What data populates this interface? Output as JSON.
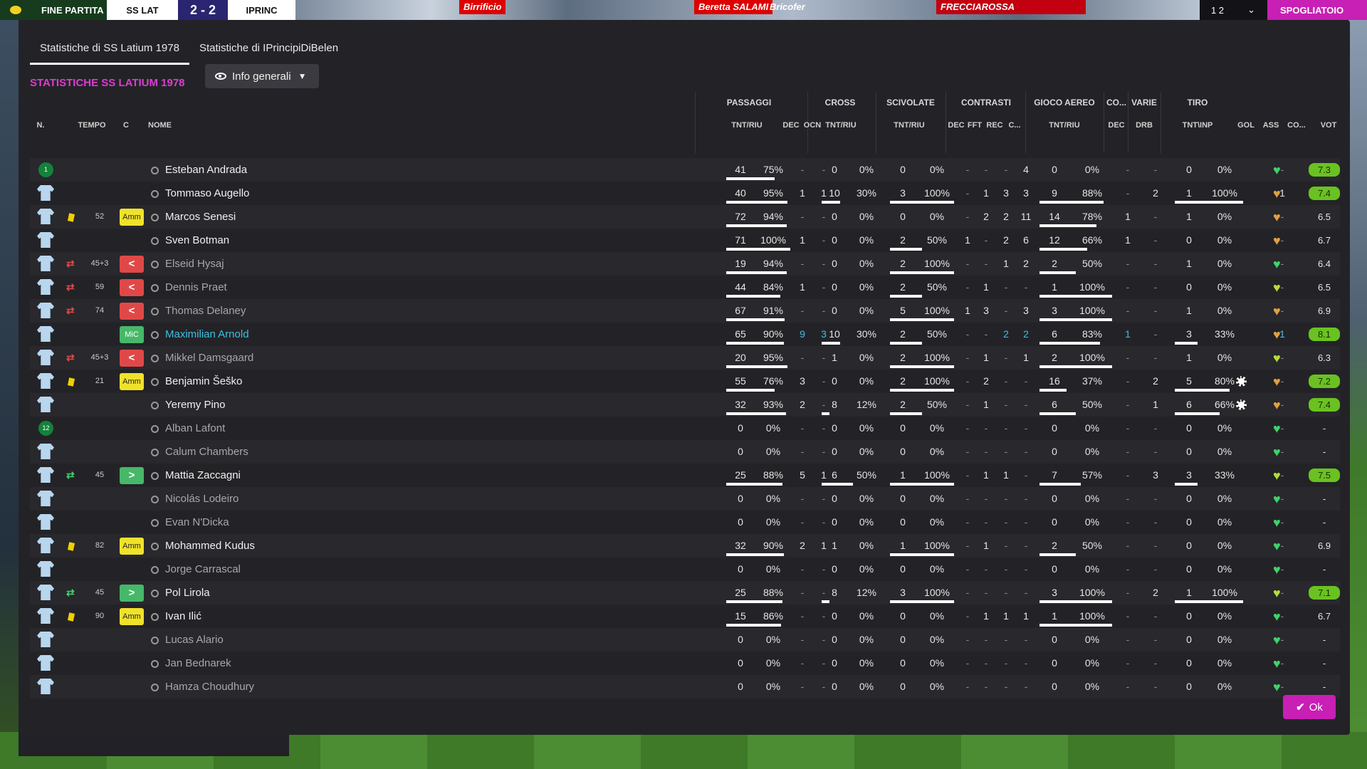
{
  "topbar": {
    "match_state": "FINE PARTITA",
    "home_short": "SS LAT",
    "score": "2 - 2",
    "away_short": "IPRINC",
    "ads": [
      "Birrificio",
      "Beretta SALAMI",
      "Bricofer",
      "FRECCIAROSSA"
    ],
    "control_1": "1 2",
    "control_2": "⌄",
    "menu_label": "SPOGLIATOIO"
  },
  "tabs": [
    {
      "label": "Statistiche di SS Latium 1978",
      "active": true
    },
    {
      "label": "Statistiche di IPrincipiDiBelen",
      "active": false
    }
  ],
  "section_title": "STATISTICHE SS LATIUM 1978",
  "view_dropdown": {
    "label": "Info generali"
  },
  "group_headers": [
    "PASSAGGI",
    "CROSS",
    "SCIVOLATE",
    "CONTRASTI",
    "GIOCO AEREO",
    "CO...",
    "VARIE",
    "TIRO"
  ],
  "column_headers": {
    "n": "N.",
    "tempo": "TEMPO",
    "c": "C",
    "nome": "NOME",
    "pass_tnt": "TNT/RIU",
    "dec": "DEC",
    "ocn": "OCN",
    "cross_tnt": "TNT/RIU",
    "scivolate_tnt": "TNT/RIU",
    "contr_dec": "DEC",
    "contr_fft": "FFT",
    "contr_rec": "REC",
    "contr_c": "C...",
    "aereo_tnt": "TNT/RIU",
    "co_dec": "DEC",
    "drb": "DRB",
    "tiro_tnt": "TNT\\INP",
    "gol": "GOL",
    "ass": "ASS",
    "co": "CO...",
    "vot": "VOT"
  },
  "heart_colors": {
    "green": "#3fd26a",
    "lime": "#b6dc3a",
    "orange": "#e0a040"
  },
  "accent": "#c81fb4",
  "players": [
    {
      "name": "Esteban Andrada",
      "status": "gk",
      "gk_num": "1",
      "yellow": false,
      "sub": "",
      "minute": "",
      "badge": "",
      "pass": "41",
      "pass_p": "75%",
      "pdec": "-",
      "pocn": "-",
      "cross": "0",
      "cross_p": "0%",
      "sciv": "0",
      "sciv_p": "0%",
      "cdec": "-",
      "cfft": "-",
      "crec": "-",
      "cc": "4",
      "aereo": "0",
      "aereo_p": "0%",
      "codec": "-",
      "drb": "-",
      "tiro": "0",
      "tiro_p": "0%",
      "gol": "",
      "ass": "-",
      "heart": "green",
      "vot": "7.3",
      "vot_hi": true,
      "dim": false,
      "cyan": false
    },
    {
      "name": "Tommaso Augello",
      "status": "",
      "gk_num": "",
      "yellow": false,
      "sub": "",
      "minute": "",
      "badge": "",
      "pass": "40",
      "pass_p": "95%",
      "pdec": "1",
      "pocn": "1",
      "cross": "10",
      "cross_p": "30%",
      "sciv": "3",
      "sciv_p": "100%",
      "cdec": "-",
      "cfft": "1",
      "crec": "3",
      "cc": "3",
      "aereo": "9",
      "aereo_p": "88%",
      "codec": "-",
      "drb": "2",
      "tiro": "1",
      "tiro_p": "100%",
      "gol": "",
      "ass": "1",
      "heart": "orange",
      "vot": "7.4",
      "vot_hi": true,
      "dim": false,
      "cyan": false
    },
    {
      "name": "Marcos Senesi",
      "status": "",
      "gk_num": "",
      "yellow": true,
      "sub": "",
      "minute": "52",
      "badge": "Amm",
      "pass": "72",
      "pass_p": "94%",
      "pdec": "-",
      "pocn": "-",
      "cross": "0",
      "cross_p": "0%",
      "sciv": "0",
      "sciv_p": "0%",
      "cdec": "-",
      "cfft": "2",
      "crec": "2",
      "cc": "11",
      "aereo": "14",
      "aereo_p": "78%",
      "codec": "1",
      "drb": "-",
      "tiro": "1",
      "tiro_p": "0%",
      "gol": "",
      "ass": "-",
      "heart": "orange",
      "vot": "6.5",
      "vot_hi": false,
      "dim": false,
      "cyan": false
    },
    {
      "name": "Sven Botman",
      "status": "",
      "gk_num": "",
      "yellow": false,
      "sub": "",
      "minute": "",
      "badge": "",
      "pass": "71",
      "pass_p": "100%",
      "pdec": "1",
      "pocn": "-",
      "cross": "0",
      "cross_p": "0%",
      "sciv": "2",
      "sciv_p": "50%",
      "cdec": "1",
      "cfft": "-",
      "crec": "2",
      "cc": "6",
      "aereo": "12",
      "aereo_p": "66%",
      "codec": "1",
      "drb": "-",
      "tiro": "0",
      "tiro_p": "0%",
      "gol": "",
      "ass": "-",
      "heart": "orange",
      "vot": "6.7",
      "vot_hi": false,
      "dim": false,
      "cyan": false
    },
    {
      "name": "Elseid Hysaj",
      "status": "",
      "gk_num": "",
      "yellow": false,
      "sub": "out",
      "minute": "45+3",
      "badge": "<",
      "pass": "19",
      "pass_p": "94%",
      "pdec": "-",
      "pocn": "-",
      "cross": "0",
      "cross_p": "0%",
      "sciv": "2",
      "sciv_p": "100%",
      "cdec": "-",
      "cfft": "-",
      "crec": "1",
      "cc": "2",
      "aereo": "2",
      "aereo_p": "50%",
      "codec": "-",
      "drb": "-",
      "tiro": "1",
      "tiro_p": "0%",
      "gol": "",
      "ass": "-",
      "heart": "green",
      "vot": "6.4",
      "vot_hi": false,
      "dim": true,
      "cyan": false
    },
    {
      "name": "Dennis Praet",
      "status": "",
      "gk_num": "",
      "yellow": false,
      "sub": "out",
      "minute": "59",
      "badge": "<",
      "pass": "44",
      "pass_p": "84%",
      "pdec": "1",
      "pocn": "-",
      "cross": "0",
      "cross_p": "0%",
      "sciv": "2",
      "sciv_p": "50%",
      "cdec": "-",
      "cfft": "1",
      "crec": "-",
      "cc": "-",
      "aereo": "1",
      "aereo_p": "100%",
      "codec": "-",
      "drb": "-",
      "tiro": "0",
      "tiro_p": "0%",
      "gol": "",
      "ass": "-",
      "heart": "lime",
      "vot": "6.5",
      "vot_hi": false,
      "dim": true,
      "cyan": false
    },
    {
      "name": "Thomas Delaney",
      "status": "",
      "gk_num": "",
      "yellow": false,
      "sub": "out",
      "minute": "74",
      "badge": "<",
      "pass": "67",
      "pass_p": "91%",
      "pdec": "-",
      "pocn": "-",
      "cross": "0",
      "cross_p": "0%",
      "sciv": "5",
      "sciv_p": "100%",
      "cdec": "1",
      "cfft": "3",
      "crec": "-",
      "cc": "3",
      "aereo": "3",
      "aereo_p": "100%",
      "codec": "-",
      "drb": "-",
      "tiro": "1",
      "tiro_p": "0%",
      "gol": "",
      "ass": "-",
      "heart": "orange",
      "vot": "6.9",
      "vot_hi": false,
      "dim": true,
      "cyan": false
    },
    {
      "name": "Maximilian Arnold",
      "status": "",
      "gk_num": "",
      "yellow": false,
      "sub": "",
      "minute": "",
      "badge": "MiC",
      "pass": "65",
      "pass_p": "90%",
      "pdec": "9",
      "pocn": "3",
      "cross": "10",
      "cross_p": "30%",
      "sciv": "2",
      "sciv_p": "50%",
      "cdec": "-",
      "cfft": "-",
      "crec": "2",
      "cc": "2",
      "aereo": "6",
      "aereo_p": "83%",
      "codec": "1",
      "drb": "-",
      "tiro": "3",
      "tiro_p": "33%",
      "gol": "",
      "ass": "1",
      "heart": "orange",
      "vot": "8.1",
      "vot_hi": true,
      "dim": false,
      "cyan": true
    },
    {
      "name": "Mikkel Damsgaard",
      "status": "",
      "gk_num": "",
      "yellow": false,
      "sub": "out",
      "minute": "45+3",
      "badge": "<",
      "pass": "20",
      "pass_p": "95%",
      "pdec": "-",
      "pocn": "-",
      "cross": "1",
      "cross_p": "0%",
      "sciv": "2",
      "sciv_p": "100%",
      "cdec": "-",
      "cfft": "1",
      "crec": "-",
      "cc": "1",
      "aereo": "2",
      "aereo_p": "100%",
      "codec": "-",
      "drb": "-",
      "tiro": "1",
      "tiro_p": "0%",
      "gol": "",
      "ass": "-",
      "heart": "lime",
      "vot": "6.3",
      "vot_hi": false,
      "dim": true,
      "cyan": false
    },
    {
      "name": "Benjamin Šeško",
      "status": "",
      "gk_num": "",
      "yellow": true,
      "sub": "",
      "minute": "21",
      "badge": "Amm",
      "pass": "55",
      "pass_p": "76%",
      "pdec": "3",
      "pocn": "-",
      "cross": "0",
      "cross_p": "0%",
      "sciv": "2",
      "sciv_p": "100%",
      "cdec": "-",
      "cfft": "2",
      "crec": "-",
      "cc": "-",
      "aereo": "16",
      "aereo_p": "37%",
      "codec": "-",
      "drb": "2",
      "tiro": "5",
      "tiro_p": "80%",
      "gol": "ball",
      "ass": "-",
      "heart": "orange",
      "vot": "7.2",
      "vot_hi": true,
      "dim": false,
      "cyan": false
    },
    {
      "name": "Yeremy Pino",
      "status": "",
      "gk_num": "",
      "yellow": false,
      "sub": "",
      "minute": "",
      "badge": "",
      "pass": "32",
      "pass_p": "93%",
      "pdec": "2",
      "pocn": "-",
      "cross": "8",
      "cross_p": "12%",
      "sciv": "2",
      "sciv_p": "50%",
      "cdec": "-",
      "cfft": "1",
      "crec": "-",
      "cc": "-",
      "aereo": "6",
      "aereo_p": "50%",
      "codec": "-",
      "drb": "1",
      "tiro": "6",
      "tiro_p": "66%",
      "gol": "ball",
      "ass": "-",
      "heart": "orange",
      "vot": "7.4",
      "vot_hi": true,
      "dim": false,
      "cyan": false
    },
    {
      "name": "Alban Lafont",
      "status": "gk",
      "gk_num": "12",
      "yellow": false,
      "sub": "",
      "minute": "",
      "badge": "",
      "pass": "0",
      "pass_p": "0%",
      "pdec": "-",
      "pocn": "-",
      "cross": "0",
      "cross_p": "0%",
      "sciv": "0",
      "sciv_p": "0%",
      "cdec": "-",
      "cfft": "-",
      "crec": "-",
      "cc": "-",
      "aereo": "0",
      "aereo_p": "0%",
      "codec": "-",
      "drb": "-",
      "tiro": "0",
      "tiro_p": "0%",
      "gol": "",
      "ass": "-",
      "heart": "green",
      "vot": "-",
      "vot_hi": false,
      "dim": true,
      "cyan": false
    },
    {
      "name": "Calum Chambers",
      "status": "",
      "gk_num": "",
      "yellow": false,
      "sub": "",
      "minute": "",
      "badge": "",
      "pass": "0",
      "pass_p": "0%",
      "pdec": "-",
      "pocn": "-",
      "cross": "0",
      "cross_p": "0%",
      "sciv": "0",
      "sciv_p": "0%",
      "cdec": "-",
      "cfft": "-",
      "crec": "-",
      "cc": "-",
      "aereo": "0",
      "aereo_p": "0%",
      "codec": "-",
      "drb": "-",
      "tiro": "0",
      "tiro_p": "0%",
      "gol": "",
      "ass": "-",
      "heart": "green",
      "vot": "-",
      "vot_hi": false,
      "dim": true,
      "cyan": false
    },
    {
      "name": "Mattia Zaccagni",
      "status": "",
      "gk_num": "",
      "yellow": false,
      "sub": "in",
      "minute": "45",
      "badge": ">",
      "pass": "25",
      "pass_p": "88%",
      "pdec": "5",
      "pocn": "1",
      "cross": "6",
      "cross_p": "50%",
      "sciv": "1",
      "sciv_p": "100%",
      "cdec": "-",
      "cfft": "1",
      "crec": "1",
      "cc": "-",
      "aereo": "7",
      "aereo_p": "57%",
      "codec": "-",
      "drb": "3",
      "tiro": "3",
      "tiro_p": "33%",
      "gol": "",
      "ass": "-",
      "heart": "lime",
      "vot": "7.5",
      "vot_hi": true,
      "dim": false,
      "cyan": false
    },
    {
      "name": "Nicolás Lodeiro",
      "status": "",
      "gk_num": "",
      "yellow": false,
      "sub": "",
      "minute": "",
      "badge": "",
      "pass": "0",
      "pass_p": "0%",
      "pdec": "-",
      "pocn": "-",
      "cross": "0",
      "cross_p": "0%",
      "sciv": "0",
      "sciv_p": "0%",
      "cdec": "-",
      "cfft": "-",
      "crec": "-",
      "cc": "-",
      "aereo": "0",
      "aereo_p": "0%",
      "codec": "-",
      "drb": "-",
      "tiro": "0",
      "tiro_p": "0%",
      "gol": "",
      "ass": "-",
      "heart": "green",
      "vot": "-",
      "vot_hi": false,
      "dim": true,
      "cyan": false
    },
    {
      "name": "Evan N'Dicka",
      "status": "",
      "gk_num": "",
      "yellow": false,
      "sub": "",
      "minute": "",
      "badge": "",
      "pass": "0",
      "pass_p": "0%",
      "pdec": "-",
      "pocn": "-",
      "cross": "0",
      "cross_p": "0%",
      "sciv": "0",
      "sciv_p": "0%",
      "cdec": "-",
      "cfft": "-",
      "crec": "-",
      "cc": "-",
      "aereo": "0",
      "aereo_p": "0%",
      "codec": "-",
      "drb": "-",
      "tiro": "0",
      "tiro_p": "0%",
      "gol": "",
      "ass": "-",
      "heart": "green",
      "vot": "-",
      "vot_hi": false,
      "dim": true,
      "cyan": false
    },
    {
      "name": "Mohammed Kudus",
      "status": "",
      "gk_num": "",
      "yellow": true,
      "sub": "",
      "minute": "82",
      "badge": "Amm",
      "pass": "32",
      "pass_p": "90%",
      "pdec": "2",
      "pocn": "1",
      "cross": "1",
      "cross_p": "0%",
      "sciv": "1",
      "sciv_p": "100%",
      "cdec": "-",
      "cfft": "1",
      "crec": "-",
      "cc": "-",
      "aereo": "2",
      "aereo_p": "50%",
      "codec": "-",
      "drb": "-",
      "tiro": "0",
      "tiro_p": "0%",
      "gol": "",
      "ass": "-",
      "heart": "green",
      "vot": "6.9",
      "vot_hi": false,
      "dim": false,
      "cyan": false
    },
    {
      "name": "Jorge Carrascal",
      "status": "",
      "gk_num": "",
      "yellow": false,
      "sub": "",
      "minute": "",
      "badge": "",
      "pass": "0",
      "pass_p": "0%",
      "pdec": "-",
      "pocn": "-",
      "cross": "0",
      "cross_p": "0%",
      "sciv": "0",
      "sciv_p": "0%",
      "cdec": "-",
      "cfft": "-",
      "crec": "-",
      "cc": "-",
      "aereo": "0",
      "aereo_p": "0%",
      "codec": "-",
      "drb": "-",
      "tiro": "0",
      "tiro_p": "0%",
      "gol": "",
      "ass": "-",
      "heart": "green",
      "vot": "-",
      "vot_hi": false,
      "dim": true,
      "cyan": false
    },
    {
      "name": "Pol Lirola",
      "status": "",
      "gk_num": "",
      "yellow": false,
      "sub": "in",
      "minute": "45",
      "badge": ">",
      "pass": "25",
      "pass_p": "88%",
      "pdec": "-",
      "pocn": "-",
      "cross": "8",
      "cross_p": "12%",
      "sciv": "3",
      "sciv_p": "100%",
      "cdec": "-",
      "cfft": "-",
      "crec": "-",
      "cc": "-",
      "aereo": "3",
      "aereo_p": "100%",
      "codec": "-",
      "drb": "2",
      "tiro": "1",
      "tiro_p": "100%",
      "gol": "",
      "ass": "-",
      "heart": "lime",
      "vot": "7.1",
      "vot_hi": true,
      "dim": false,
      "cyan": false
    },
    {
      "name": "Ivan Ilić",
      "status": "",
      "gk_num": "",
      "yellow": true,
      "sub": "",
      "minute": "90",
      "badge": "Amm",
      "pass": "15",
      "pass_p": "86%",
      "pdec": "-",
      "pocn": "-",
      "cross": "0",
      "cross_p": "0%",
      "sciv": "0",
      "sciv_p": "0%",
      "cdec": "-",
      "cfft": "1",
      "crec": "1",
      "cc": "1",
      "aereo": "1",
      "aereo_p": "100%",
      "codec": "-",
      "drb": "-",
      "tiro": "0",
      "tiro_p": "0%",
      "gol": "",
      "ass": "-",
      "heart": "green",
      "vot": "6.7",
      "vot_hi": false,
      "dim": false,
      "cyan": false
    },
    {
      "name": "Lucas Alario",
      "status": "",
      "gk_num": "",
      "yellow": false,
      "sub": "",
      "minute": "",
      "badge": "",
      "pass": "0",
      "pass_p": "0%",
      "pdec": "-",
      "pocn": "-",
      "cross": "0",
      "cross_p": "0%",
      "sciv": "0",
      "sciv_p": "0%",
      "cdec": "-",
      "cfft": "-",
      "crec": "-",
      "cc": "-",
      "aereo": "0",
      "aereo_p": "0%",
      "codec": "-",
      "drb": "-",
      "tiro": "0",
      "tiro_p": "0%",
      "gol": "",
      "ass": "-",
      "heart": "green",
      "vot": "-",
      "vot_hi": false,
      "dim": true,
      "cyan": false
    },
    {
      "name": "Jan Bednarek",
      "status": "",
      "gk_num": "",
      "yellow": false,
      "sub": "",
      "minute": "",
      "badge": "",
      "pass": "0",
      "pass_p": "0%",
      "pdec": "-",
      "pocn": "-",
      "cross": "0",
      "cross_p": "0%",
      "sciv": "0",
      "sciv_p": "0%",
      "cdec": "-",
      "cfft": "-",
      "crec": "-",
      "cc": "-",
      "aereo": "0",
      "aereo_p": "0%",
      "codec": "-",
      "drb": "-",
      "tiro": "0",
      "tiro_p": "0%",
      "gol": "",
      "ass": "-",
      "heart": "green",
      "vot": "-",
      "vot_hi": false,
      "dim": true,
      "cyan": false
    },
    {
      "name": "Hamza Choudhury",
      "status": "",
      "gk_num": "",
      "yellow": false,
      "sub": "",
      "minute": "",
      "badge": "",
      "pass": "0",
      "pass_p": "0%",
      "pdec": "-",
      "pocn": "-",
      "cross": "0",
      "cross_p": "0%",
      "sciv": "0",
      "sciv_p": "0%",
      "cdec": "-",
      "cfft": "-",
      "crec": "-",
      "cc": "-",
      "aereo": "0",
      "aereo_p": "0%",
      "codec": "-",
      "drb": "-",
      "tiro": "0",
      "tiro_p": "0%",
      "gol": "",
      "ass": "-",
      "heart": "green",
      "vot": "-",
      "vot_hi": false,
      "dim": true,
      "cyan": false
    }
  ],
  "ok_button": {
    "label": "Ok"
  }
}
